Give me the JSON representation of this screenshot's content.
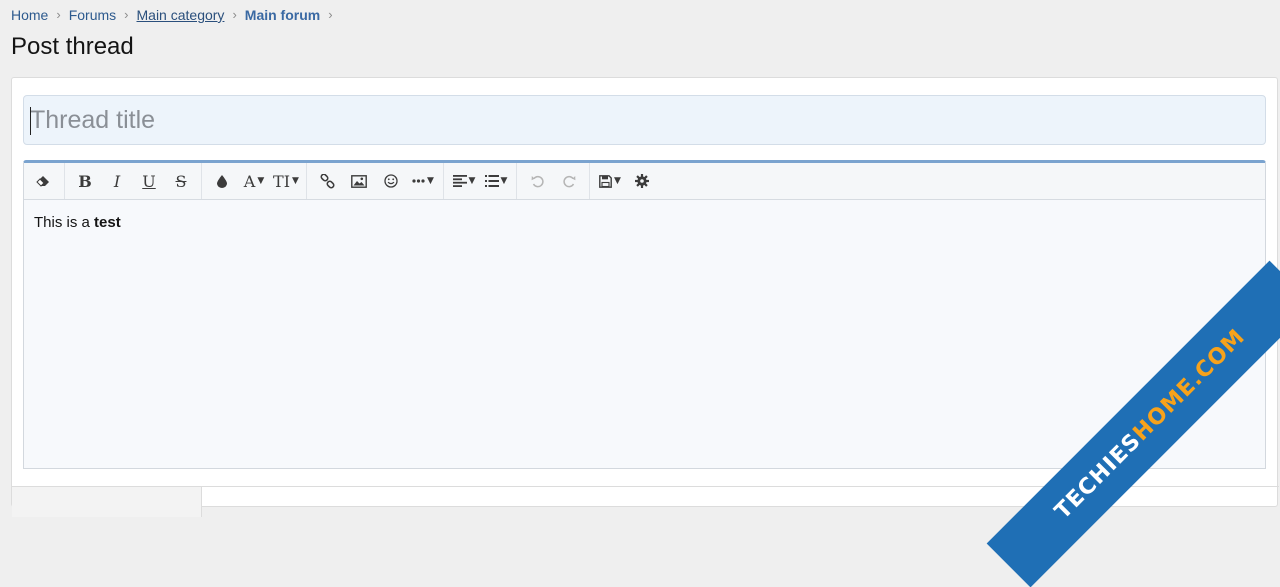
{
  "breadcrumb": {
    "items": [
      {
        "label": "Home"
      },
      {
        "label": "Forums"
      },
      {
        "label": "Main category"
      },
      {
        "label": "Main forum"
      }
    ],
    "separator": "›"
  },
  "page": {
    "title": "Post thread"
  },
  "form": {
    "title_placeholder": "Thread title",
    "title_value": ""
  },
  "editor": {
    "toolbar": [
      {
        "name": "remove-formatting",
        "icon": "eraser-icon"
      },
      {
        "name": "bold",
        "label": "B"
      },
      {
        "name": "italic",
        "label": "I"
      },
      {
        "name": "underline",
        "label": "U"
      },
      {
        "name": "strikethrough",
        "label": "S"
      },
      {
        "name": "text-color",
        "icon": "droplet-icon"
      },
      {
        "name": "font-family",
        "label": "A"
      },
      {
        "name": "font-size",
        "label": "TI"
      },
      {
        "name": "insert-link",
        "icon": "link-icon"
      },
      {
        "name": "insert-image",
        "icon": "image-icon"
      },
      {
        "name": "smilies",
        "icon": "smiley-icon"
      },
      {
        "name": "more-options",
        "icon": "ellipsis-icon"
      },
      {
        "name": "align",
        "icon": "align-left-icon"
      },
      {
        "name": "list",
        "icon": "list-icon"
      },
      {
        "name": "undo",
        "icon": "undo-icon"
      },
      {
        "name": "redo",
        "icon": "redo-icon"
      },
      {
        "name": "drafts",
        "icon": "save-icon"
      },
      {
        "name": "settings",
        "icon": "gear-icon"
      }
    ],
    "content": {
      "plain": "This is a ",
      "bold": "test"
    }
  },
  "watermark": {
    "prefix": "TECHIES",
    "accent": "HOME.COM"
  },
  "colors": {
    "link": "#2d5a8e",
    "editor_top_border": "#7aa3cf",
    "title_bg": "#edf4fb",
    "watermark_bg": "#1f6fb5",
    "watermark_accent": "#f7a21b"
  }
}
